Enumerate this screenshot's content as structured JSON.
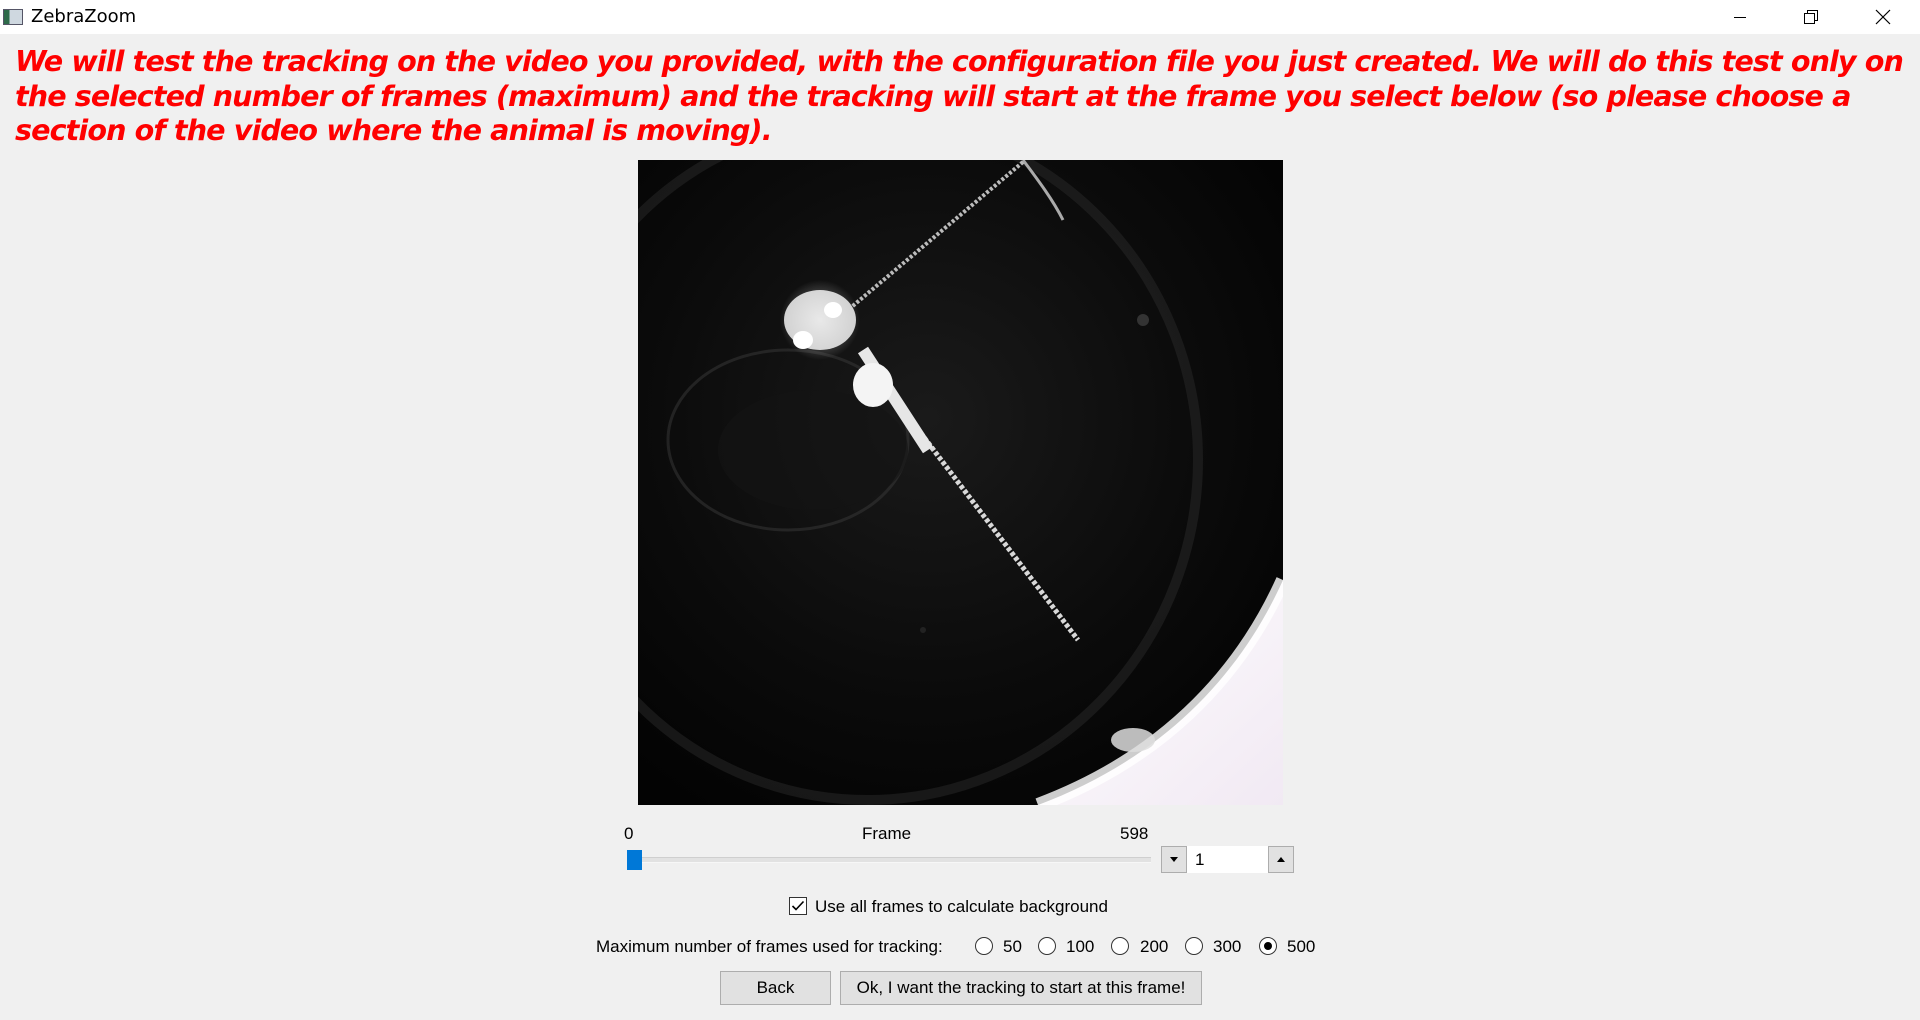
{
  "window": {
    "title": "ZebraZoom",
    "icons": [
      "app-icon",
      "minimize-icon",
      "restore-icon",
      "close-icon"
    ]
  },
  "instructions": "We will test the tracking on the video you provided, with the configuration file you just created. We will do this test only on the selected number of frames (maximum) and the tracking will start at the frame you select below (so please choose a section of the video where the animal is moving).",
  "frame_slider": {
    "min_label": "0",
    "title": "Frame",
    "max_label": "598",
    "current_value": "1",
    "position_fraction": 0.0
  },
  "background_option": {
    "label": "Use all frames to calculate background",
    "checked": true
  },
  "max_frames": {
    "label": "Maximum number of frames used for tracking:",
    "options": [
      "50",
      "100",
      "200",
      "300",
      "500"
    ],
    "selected": "500"
  },
  "buttons": {
    "back": "Back",
    "ok": "Ok, I want the tracking to start at this frame!"
  },
  "colors": {
    "instruction_text": "#ff0000",
    "slider_handle": "#0078d7",
    "background": "#f0f0f0"
  }
}
